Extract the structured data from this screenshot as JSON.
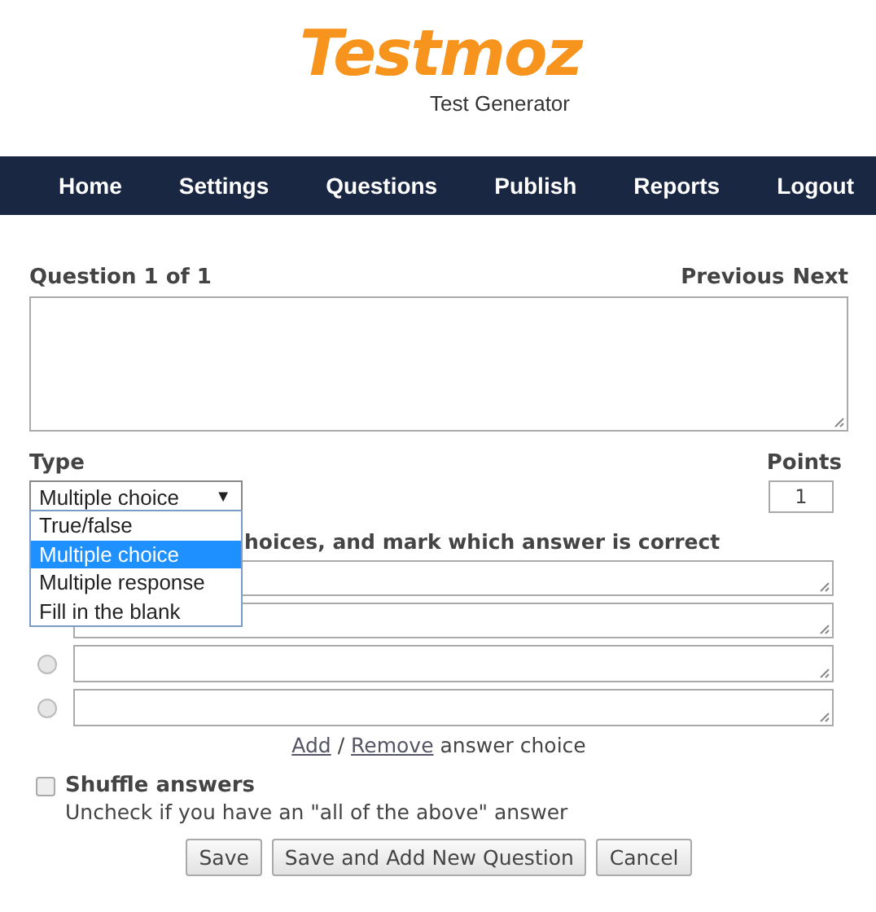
{
  "logo": {
    "name": "Testmoz",
    "tagline": "Test Generator"
  },
  "nav": [
    {
      "label": "Home"
    },
    {
      "label": "Settings"
    },
    {
      "label": "Questions"
    },
    {
      "label": "Publish"
    },
    {
      "label": "Reports"
    },
    {
      "label": "Logout"
    }
  ],
  "question": {
    "heading": "Question 1 of 1",
    "previous": "Previous",
    "next": "Next"
  },
  "type": {
    "label": "Type",
    "value": "Multiple choice",
    "caret": "▼",
    "expanded": true,
    "options": [
      {
        "label": "True/false",
        "selected": false
      },
      {
        "label": "Multiple choice",
        "selected": true
      },
      {
        "label": "Multiple response",
        "selected": false
      },
      {
        "label": "Fill in the blank",
        "selected": false
      }
    ]
  },
  "points": {
    "label": "Points",
    "value": "1"
  },
  "instruction": "hoices, and mark which answer is correct",
  "answers": [
    {
      "kind": "field"
    },
    {
      "kind": "field"
    },
    {
      "kind": "radio_field",
      "selected": false
    },
    {
      "kind": "radio_field",
      "selected": false
    }
  ],
  "add_remove": {
    "add": "Add",
    "separator": "/",
    "remove": "Remove",
    "suffix": "answer choice"
  },
  "shuffle": {
    "label": "Shuffle answers",
    "checked": false,
    "hint": "Uncheck if you have an \"all of the above\" answer"
  },
  "buttons": [
    "Save",
    "Save and Add New Question",
    "Cancel"
  ]
}
